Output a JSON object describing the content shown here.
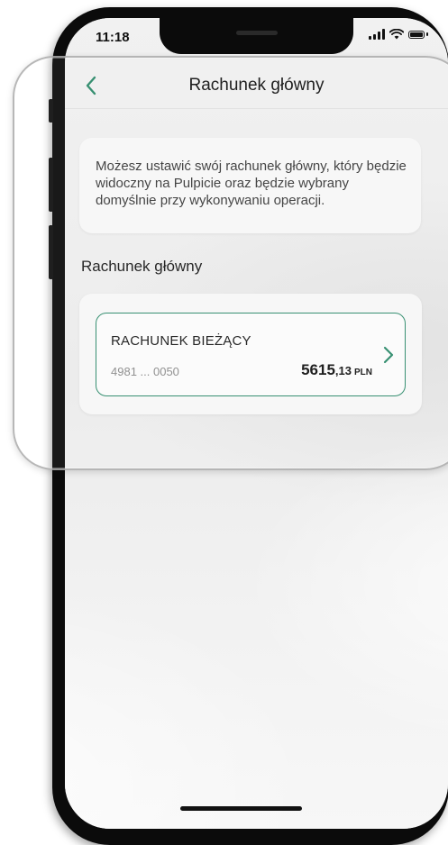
{
  "status_bar": {
    "time": "11:18"
  },
  "header": {
    "title": "Rachunek główny",
    "back_icon": "chevron-left-icon"
  },
  "info": {
    "text": "Możesz ustawić swój rachunek główny, który będzie widoczny na Pulpicie oraz będzie wybrany domyślnie przy wykonywaniu operacji."
  },
  "section": {
    "title": "Rachunek główny"
  },
  "account": {
    "name": "RACHUNEK BIEŻĄCY",
    "number": "4981 ... 0050",
    "balance_int": "5615",
    "balance_dec": ",13",
    "currency": "PLN",
    "chevron_icon": "chevron-right-icon"
  },
  "colors": {
    "accent": "#2c8a6a",
    "text": "#1a1a1a",
    "muted": "#8b8b8b"
  }
}
